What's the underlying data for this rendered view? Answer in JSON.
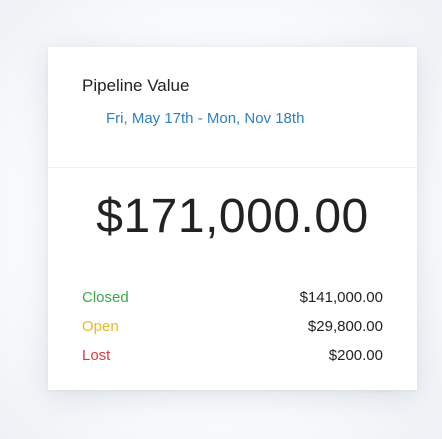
{
  "card": {
    "title": "Pipeline Value",
    "date_range": "Fri, May 17th - Mon, Nov 18th",
    "total": "$171,000.00",
    "breakdown": [
      {
        "label": "Closed",
        "amount": "$141,000.00",
        "color": "#3aa94a"
      },
      {
        "label": "Open",
        "amount": "$29,800.00",
        "color": "#e8b92a"
      },
      {
        "label": "Lost",
        "amount": "$200.00",
        "color": "#e0393e"
      }
    ]
  }
}
